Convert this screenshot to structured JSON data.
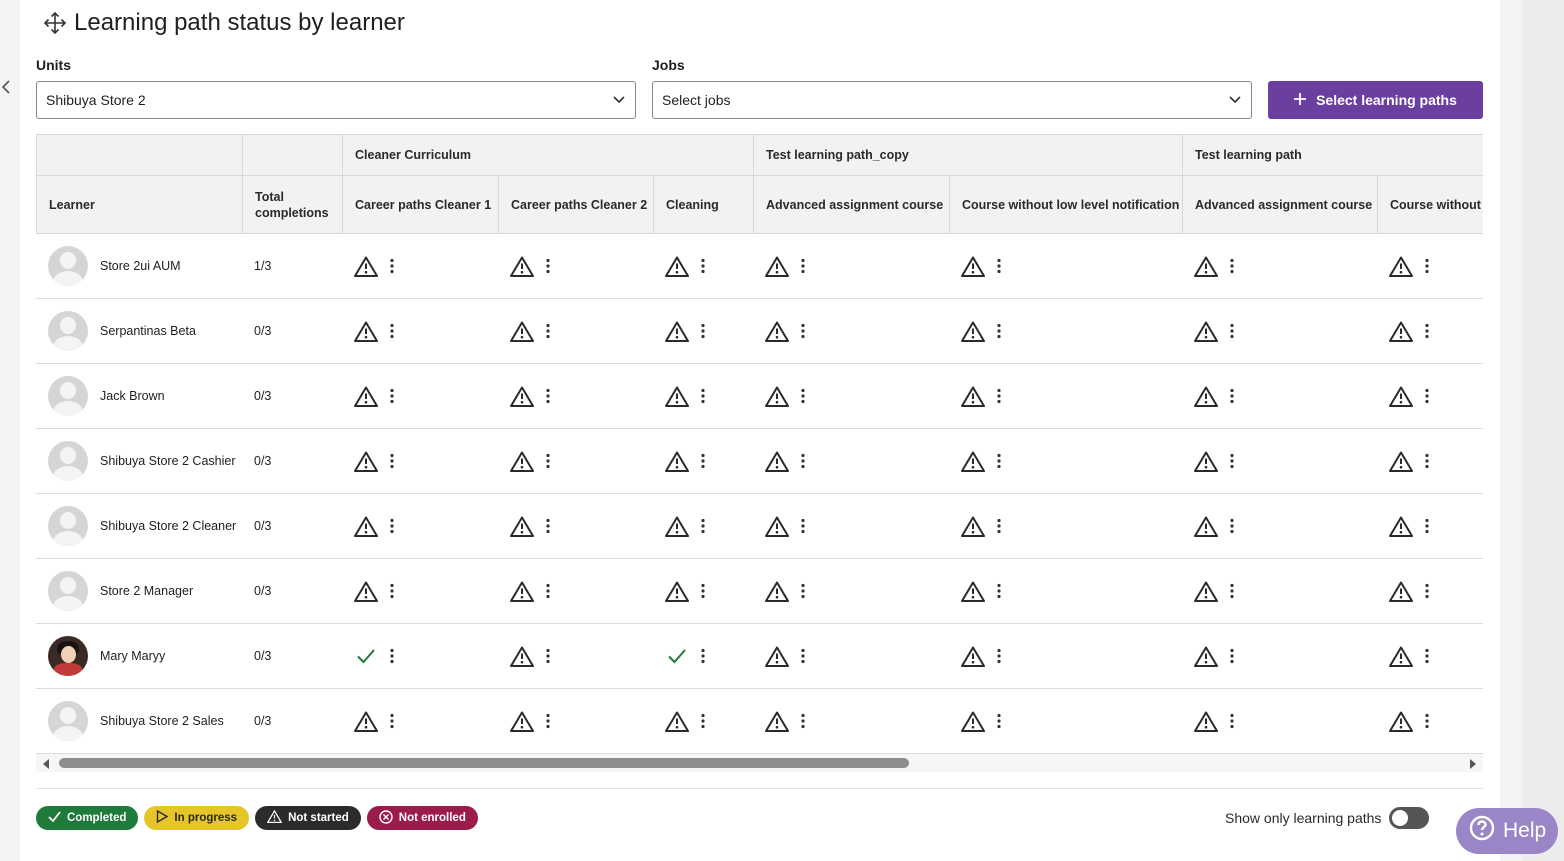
{
  "page": {
    "title": "Learning path status by learner"
  },
  "filters": {
    "units_label": "Units",
    "units_value": "Shibuya Store 2",
    "jobs_label": "Jobs",
    "jobs_placeholder": "Select jobs",
    "select_paths_button": "Select learning paths"
  },
  "table": {
    "group_headers": [
      {
        "label": ""
      },
      {
        "label": ""
      },
      {
        "label": "Cleaner Curriculum"
      },
      {
        "label": "Test learning path_copy"
      },
      {
        "label": "Test learning path"
      }
    ],
    "columns": [
      {
        "label": "Learner"
      },
      {
        "label": "Total completions"
      },
      {
        "label": "Career paths Cleaner 1"
      },
      {
        "label": "Career paths Cleaner 2"
      },
      {
        "label": "Cleaning"
      },
      {
        "label": "Advanced assignment course"
      },
      {
        "label": "Course without low level notification"
      },
      {
        "label": "Advanced assignment course"
      },
      {
        "label": "Course without low level notification"
      }
    ],
    "rows": [
      {
        "name": "Store 2ui AUM",
        "total": "1/3",
        "avatar": "placeholder",
        "statuses": [
          "not-started",
          "not-started",
          "not-started",
          "not-started",
          "not-started",
          "not-started",
          "not-started"
        ]
      },
      {
        "name": "Serpantinas Beta",
        "total": "0/3",
        "avatar": "placeholder",
        "statuses": [
          "not-started",
          "not-started",
          "not-started",
          "not-started",
          "not-started",
          "not-started",
          "not-started"
        ]
      },
      {
        "name": "Jack Brown",
        "total": "0/3",
        "avatar": "placeholder",
        "statuses": [
          "not-started",
          "not-started",
          "not-started",
          "not-started",
          "not-started",
          "not-started",
          "not-started"
        ]
      },
      {
        "name": "Shibuya Store 2 Cashier",
        "total": "0/3",
        "avatar": "placeholder",
        "statuses": [
          "not-started",
          "not-started",
          "not-started",
          "not-started",
          "not-started",
          "not-started",
          "not-started"
        ]
      },
      {
        "name": "Shibuya Store 2 Cleaner",
        "total": "0/3",
        "avatar": "placeholder",
        "statuses": [
          "not-started",
          "not-started",
          "not-started",
          "not-started",
          "not-started",
          "not-started",
          "not-started"
        ]
      },
      {
        "name": "Store 2 Manager",
        "total": "0/3",
        "avatar": "placeholder",
        "statuses": [
          "not-started",
          "not-started",
          "not-started",
          "not-started",
          "not-started",
          "not-started",
          "not-started"
        ]
      },
      {
        "name": "Mary Maryy",
        "total": "0/3",
        "avatar": "photo",
        "statuses": [
          "completed",
          "not-started",
          "completed",
          "not-started",
          "not-started",
          "not-started",
          "not-started"
        ]
      },
      {
        "name": "Shibuya Store 2 Sales",
        "total": "0/3",
        "avatar": "placeholder",
        "statuses": [
          "not-started",
          "not-started",
          "not-started",
          "not-started",
          "not-started",
          "not-started",
          "not-started"
        ]
      }
    ]
  },
  "legend": {
    "completed": "Completed",
    "in_progress": "In progress",
    "not_started": "Not started",
    "not_enrolled": "Not enrolled"
  },
  "toggle": {
    "label": "Show only learning paths",
    "checked": false
  },
  "help": {
    "label": "Help"
  },
  "colors": {
    "primary": "#6b3fa0",
    "completed": "#1e7b3a",
    "in_progress": "#e6c52b",
    "not_started": "#2b2b2b",
    "not_enrolled": "#9b1c4a",
    "help": "#9a86c7"
  },
  "icons": {
    "title": "move-icon",
    "status_not_started": "warning-triangle-icon",
    "status_completed": "checkmark-icon",
    "row_menu": "kebab-menu-icon"
  }
}
